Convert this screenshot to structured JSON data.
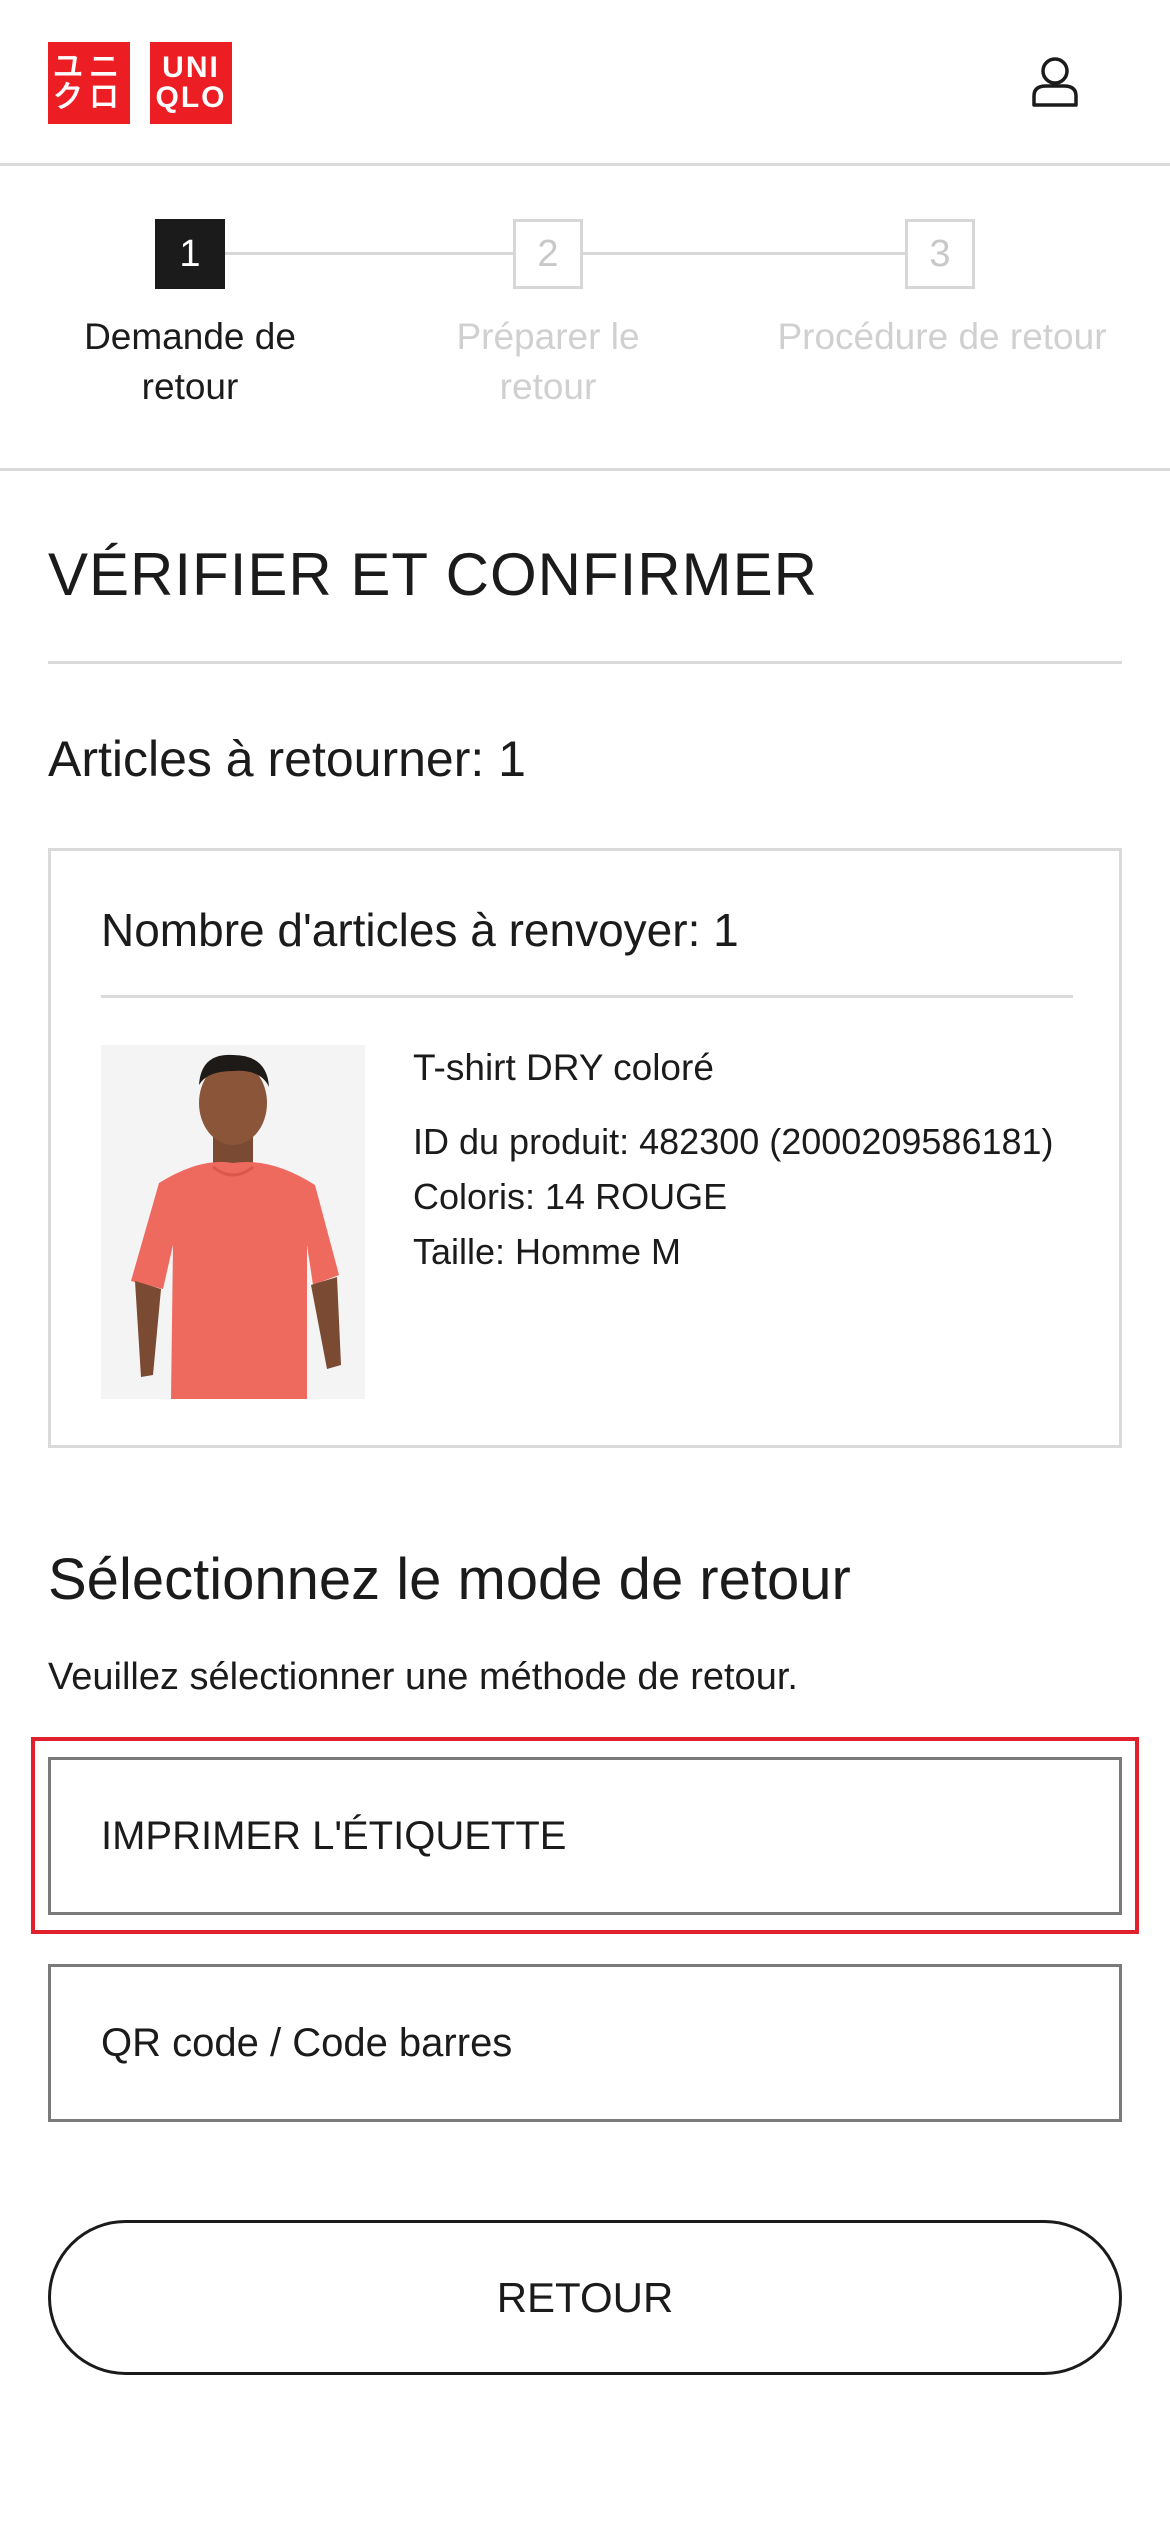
{
  "brand": {
    "logo_left_rows": [
      "ユニ",
      "クロ"
    ],
    "logo_right_rows": [
      "UNI",
      "QLO"
    ],
    "color": "#ed1d24"
  },
  "header": {
    "account_icon": "user-icon"
  },
  "stepper": {
    "steps": [
      {
        "number": "1",
        "label_line1": "Demande de",
        "label_line2": "retour",
        "active": true
      },
      {
        "number": "2",
        "label_line1": "Préparer le",
        "label_line2": "retour",
        "active": false
      },
      {
        "number": "3",
        "label_line1": "Procédure de retour",
        "label_line2": "",
        "active": false
      }
    ]
  },
  "main": {
    "title": "VÉRIFIER ET CONFIRMER",
    "articles_count_label": "Articles à retourner: 1"
  },
  "card": {
    "title": "Nombre d'articles à renvoyer: 1",
    "product": {
      "name": "T-shirt DRY coloré",
      "id_line": "ID du produit: 482300 (2000209586181)",
      "color_line": "Coloris: 14 ROUGE",
      "size_line": "Taille: Homme M",
      "shirt_color": "#ee6a5f"
    }
  },
  "return_mode": {
    "title": "Sélectionnez le mode de retour",
    "subtitle": "Veuillez sélectionner une méthode de retour.",
    "options": [
      {
        "label": "IMPRIMER L'ÉTIQUETTE",
        "highlighted": true
      },
      {
        "label": "QR code / Code barres",
        "highlighted": false
      }
    ],
    "highlight_color": "#e0202b"
  },
  "footer": {
    "back_button": "RETOUR"
  }
}
